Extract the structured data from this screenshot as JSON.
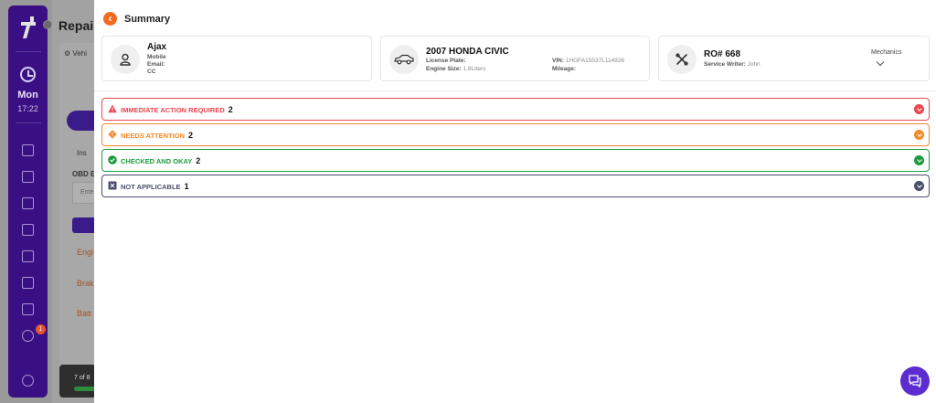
{
  "background": {
    "sidebar": {
      "day": "Mon",
      "time": "17:22",
      "notification_count": "1"
    },
    "page_title": "Repair",
    "tab_label": "Vehi",
    "section_label": "Ins",
    "obd_label": "OBD E",
    "input_placeholder": "Ente",
    "links": [
      "Engi",
      "Brak",
      "Batt"
    ],
    "progress_text": "7 of 8"
  },
  "drawer": {
    "title": "Summary",
    "customer": {
      "name": "Ajax",
      "mobile_label": "Mobile",
      "email_label": "Email:",
      "cc_label": "CC"
    },
    "vehicle": {
      "title": "2007 HONDA CIVIC",
      "license_label": "License Plate:",
      "engine_label": "Engine Size:",
      "engine_value": "1.8Liters",
      "vin_label": "VIN:",
      "vin_value": "1HGFA15537L114926",
      "mileage_label": "Mileage:"
    },
    "repair_order": {
      "title": "RO# 668",
      "writer_label": "Service Writer:",
      "writer_value": "John",
      "mechanics_label": "Mechanics"
    },
    "statuses": [
      {
        "label": "IMMEDIATE ACTION REQUIRED",
        "count": "2",
        "color": "#e8474f",
        "icon": "warning-triangle-icon"
      },
      {
        "label": "NEEDS ATTENTION",
        "count": "2",
        "color": "#f0892a",
        "icon": "alert-diamond-icon"
      },
      {
        "label": "CHECKED AND OKAY",
        "count": "2",
        "color": "#1e9a3e",
        "icon": "check-circle-icon"
      },
      {
        "label": "NOT APPLICABLE",
        "count": "1",
        "color": "#4b4f6e",
        "icon": "x-square-icon"
      }
    ]
  },
  "colors": {
    "brand_purple": "#3b0f84",
    "chat_purple": "#5b2ccf",
    "back_orange": "#f26a22"
  }
}
